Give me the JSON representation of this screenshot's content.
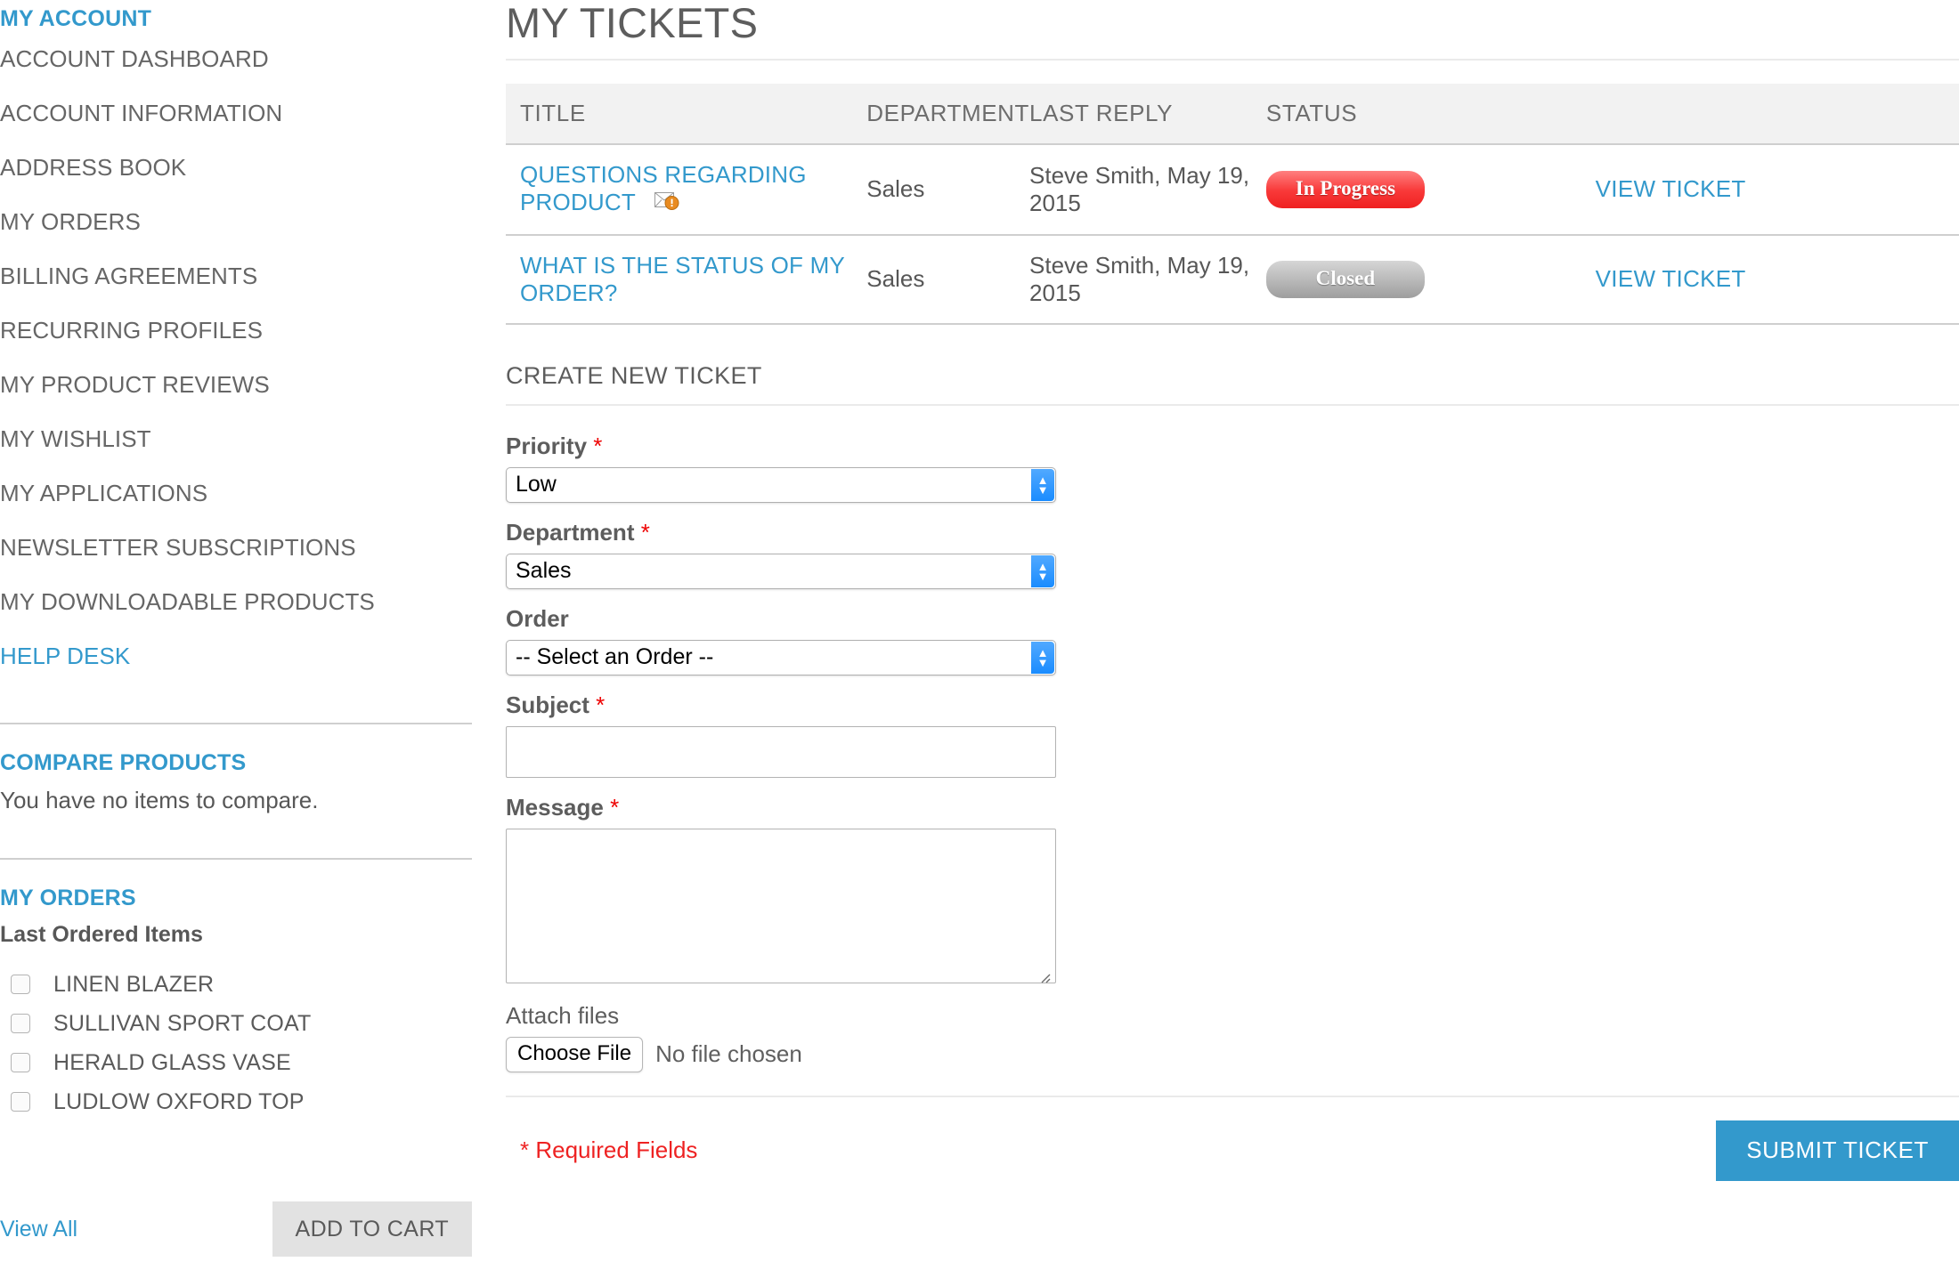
{
  "sidebar": {
    "account": {
      "title": "MY ACCOUNT",
      "items": [
        {
          "label": "ACCOUNT DASHBOARD",
          "current": false
        },
        {
          "label": "ACCOUNT INFORMATION",
          "current": false
        },
        {
          "label": "ADDRESS BOOK",
          "current": false
        },
        {
          "label": "MY ORDERS",
          "current": false
        },
        {
          "label": "BILLING AGREEMENTS",
          "current": false
        },
        {
          "label": "RECURRING PROFILES",
          "current": false
        },
        {
          "label": "MY PRODUCT REVIEWS",
          "current": false
        },
        {
          "label": "MY WISHLIST",
          "current": false
        },
        {
          "label": "MY APPLICATIONS",
          "current": false
        },
        {
          "label": "NEWSLETTER SUBSCRIPTIONS",
          "current": false
        },
        {
          "label": "MY DOWNLOADABLE PRODUCTS",
          "current": false
        },
        {
          "label": "HELP DESK",
          "current": true
        }
      ]
    },
    "compare": {
      "title": "COMPARE PRODUCTS",
      "empty_text": "You have no items to compare."
    },
    "orders": {
      "title": "MY ORDERS",
      "subtitle": "Last Ordered Items",
      "items": [
        {
          "name": "LINEN BLAZER"
        },
        {
          "name": "SULLIVAN SPORT COAT"
        },
        {
          "name": "HERALD GLASS VASE"
        },
        {
          "name": "LUDLOW OXFORD TOP"
        }
      ],
      "view_all_label": "View All",
      "add_to_cart_label": "ADD TO CART"
    }
  },
  "main": {
    "page_title": "MY TICKETS",
    "table": {
      "columns": [
        "TITLE",
        "DEPARTMENT",
        "LAST REPLY",
        "STATUS",
        ""
      ],
      "rows": [
        {
          "title": "QUESTIONS REGARDING PRODUCT",
          "has_alert_icon": true,
          "department": "Sales",
          "last_reply": "Steve Smith, May 19, 2015",
          "status": "In Progress",
          "status_kind": "inprogress",
          "action": "VIEW TICKET"
        },
        {
          "title": "WHAT IS THE STATUS OF MY ORDER?",
          "has_alert_icon": false,
          "department": "Sales",
          "last_reply": "Steve Smith, May 19, 2015",
          "status": "Closed",
          "status_kind": "closed",
          "action": "VIEW TICKET"
        }
      ]
    },
    "form": {
      "section_title": "CREATE NEW TICKET",
      "priority": {
        "label": "Priority",
        "required": true,
        "value": "Low"
      },
      "department": {
        "label": "Department",
        "required": true,
        "value": "Sales"
      },
      "order": {
        "label": "Order",
        "required": false,
        "value": "-- Select an Order --"
      },
      "subject": {
        "label": "Subject",
        "required": true,
        "value": "",
        "placeholder": ""
      },
      "message": {
        "label": "Message",
        "required": true,
        "value": "",
        "placeholder": ""
      },
      "attach": {
        "label": "Attach files",
        "button_label": "Choose File",
        "status_text": "No file chosen"
      },
      "required_note": "* Required Fields",
      "submit_label": "SUBMIT TICKET"
    }
  },
  "colors": {
    "accent": "#3399cc",
    "required": "#ee2222",
    "status_in_progress": "#f93a3a",
    "status_closed": "#b9b9b9",
    "table_header_bg": "#f2f2f2"
  }
}
